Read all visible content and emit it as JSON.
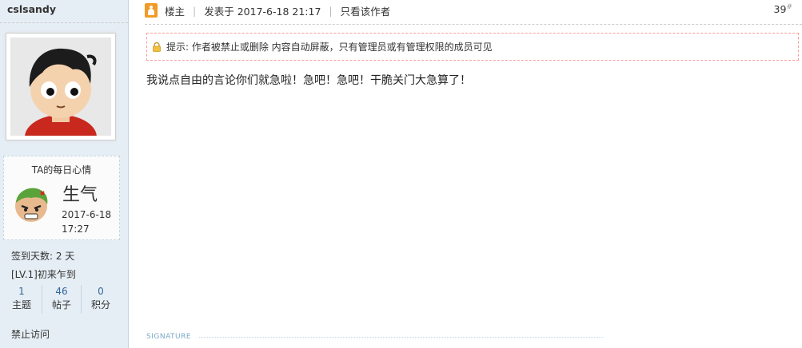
{
  "user": {
    "username": "cslsandy",
    "mood_title": "TA的每日心情",
    "mood_word": "生气",
    "mood_date": "2017-6-18 17:27",
    "checkin": "签到天数: 2 天",
    "level": "[LV.1]初来乍到",
    "stats": [
      {
        "value": "1",
        "label": "主题"
      },
      {
        "value": "46",
        "label": "帖子"
      },
      {
        "value": "0",
        "label": "积分"
      }
    ],
    "status": "禁止访问"
  },
  "post": {
    "role": "楼主",
    "posted_at": "发表于 2017-6-18 21:17",
    "only_author": "只看该作者",
    "floor": "39",
    "floor_mark": "#",
    "notice": "提示: 作者被禁止或删除 内容自动屏蔽，只有管理员或有管理权限的成员可见",
    "content": "我说点自由的言论你们就急啦！急吧！急吧！干脆关门大急算了！",
    "signature_label": "SIGNATURE"
  },
  "colors": {
    "sidebar_bg": "#e6eef5",
    "notice_border": "#ff9a9a",
    "floor_icon": "#f29a25"
  }
}
